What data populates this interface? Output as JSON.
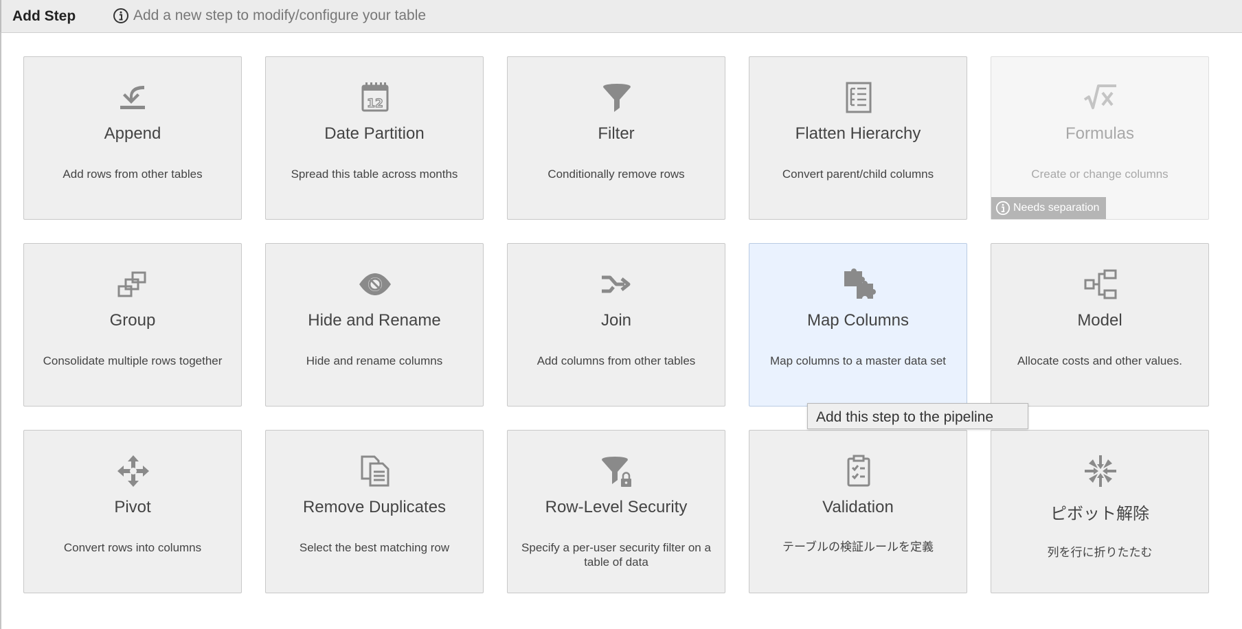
{
  "header": {
    "title": "Add Step",
    "info_text": "Add a new step to modify/configure your table",
    "icon": "info-circle-icon"
  },
  "cards": [
    {
      "key": "append",
      "name": "Append",
      "desc": "Add rows from other tables",
      "icon": "append-icon"
    },
    {
      "key": "date-partition",
      "name": "Date Partition",
      "desc": "Spread this table across months",
      "icon": "calendar-icon"
    },
    {
      "key": "filter",
      "name": "Filter",
      "desc": "Conditionally remove rows",
      "icon": "funnel-icon"
    },
    {
      "key": "flatten-hierarchy",
      "name": "Flatten Hierarchy",
      "desc": "Convert parent/child columns",
      "icon": "hierarchy-list-icon"
    },
    {
      "key": "formulas",
      "name": "Formulas",
      "desc": "Create or change columns",
      "icon": "square-root-icon",
      "disabled": true,
      "badge": "Needs separation"
    },
    {
      "key": "group",
      "name": "Group",
      "desc": "Consolidate multiple rows together",
      "icon": "group-windows-icon"
    },
    {
      "key": "hide-and-rename",
      "name": "Hide and Rename",
      "desc": "Hide and rename columns",
      "icon": "eye-slash-icon"
    },
    {
      "key": "join",
      "name": "Join",
      "desc": "Add columns from other tables",
      "icon": "merge-arrows-icon"
    },
    {
      "key": "map-columns",
      "name": "Map Columns",
      "desc": "Map columns to a master data set",
      "icon": "puzzle-icon",
      "hover": true
    },
    {
      "key": "model",
      "name": "Model",
      "desc": "Allocate costs and other values.",
      "icon": "tree-nodes-icon"
    },
    {
      "key": "pivot",
      "name": "Pivot",
      "desc": "Convert rows into columns",
      "icon": "move-arrows-icon"
    },
    {
      "key": "remove-duplicates",
      "name": "Remove Duplicates",
      "desc": "Select the best matching row",
      "icon": "copy-documents-icon"
    },
    {
      "key": "row-level-security",
      "name": "Row-Level Security",
      "desc": "Specify a per-user security filter on a table of data",
      "icon": "funnel-lock-icon"
    },
    {
      "key": "validation",
      "name": "Validation",
      "desc": "テーブルの検証ルールを定義",
      "icon": "clipboard-check-icon"
    },
    {
      "key": "unpivot",
      "name": "ピボット解除",
      "desc": "列を行に折りたたむ",
      "icon": "compress-arrows-icon"
    }
  ],
  "tooltip": {
    "text": "Add this step to the pipeline"
  },
  "colors": {
    "icon": "#8a8a8a",
    "icon_disabled": "#c4c4c4",
    "hover_bg": "#eaf2fe",
    "badge_bg": "#b5b5b5"
  }
}
